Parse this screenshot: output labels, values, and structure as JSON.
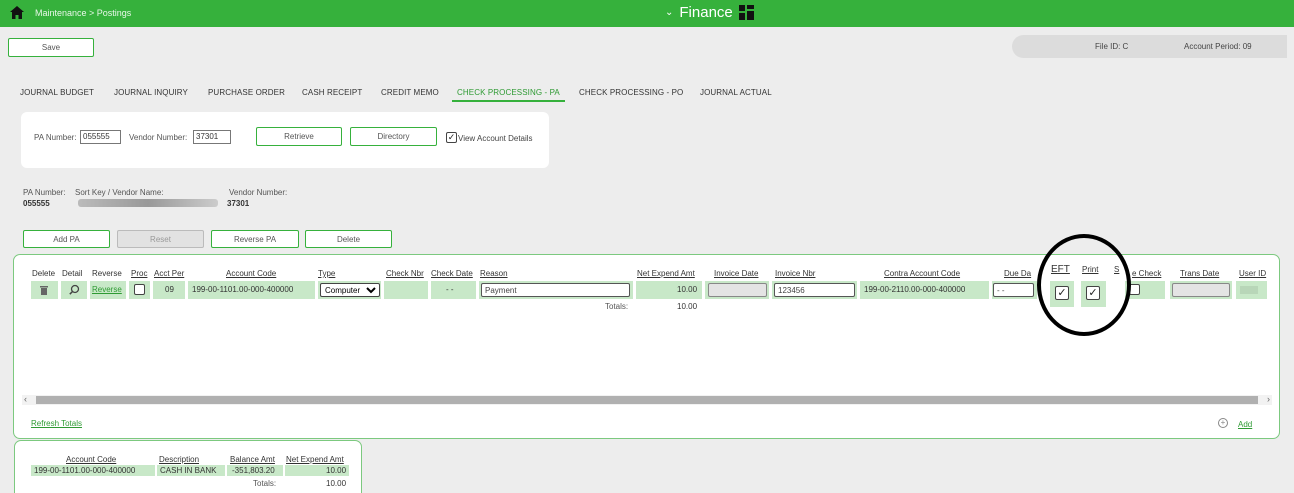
{
  "header": {
    "breadcrumb": "Maintenance > Postings",
    "app_title": "Finance",
    "chevron": "⌄"
  },
  "toolbar": {
    "save_label": "Save"
  },
  "file_info": {
    "file_id": "File ID: C",
    "account_period": "Account Period: 09"
  },
  "tabs": [
    "JOURNAL BUDGET",
    "JOURNAL INQUIRY",
    "PURCHASE ORDER",
    "CASH RECEIPT",
    "CREDIT MEMO",
    "CHECK PROCESSING - PA",
    "CHECK PROCESSING - PO",
    "JOURNAL ACTUAL"
  ],
  "active_tab": "CHECK PROCESSING - PA",
  "search": {
    "pa_number_label": "PA Number:",
    "pa_number_value": "055555",
    "vendor_number_label": "Vendor Number:",
    "vendor_number_value": "37301",
    "retrieve_label": "Retrieve",
    "directory_label": "Directory",
    "view_details_label": "View Account Details",
    "view_details_checked": true
  },
  "info": {
    "pa_number_label": "PA Number:",
    "sort_key_label": "Sort Key / Vendor Name:",
    "vendor_number_label": "Vendor Number:",
    "pa_number_value": "055555",
    "vendor_number_value": "37301"
  },
  "actions": {
    "add_pa": "Add PA",
    "reset": "Reset",
    "reverse_pa": "Reverse PA",
    "delete": "Delete"
  },
  "grid": {
    "headers": {
      "delete": "Delete",
      "detail": "Detail",
      "reverse": "Reverse",
      "proc": "Proc",
      "acct_per": "Acct Per",
      "account_code": "Account Code",
      "type": "Type",
      "check_nbr": "Check Nbr",
      "check_date": "Check Date",
      "reason": "Reason",
      "net_expend_amt": "Net Expend Amt",
      "invoice_date": "Invoice Date",
      "invoice_nbr": "Invoice Nbr",
      "contra_account_code": "Contra Account Code",
      "due_date": "Due Da",
      "eft": "EFT",
      "print": "Print",
      "s_glyph": "S",
      "single_check": "e Check",
      "trans_date": "Trans Date",
      "user_id": "User ID"
    },
    "row": {
      "reverse_link": "Reverse",
      "acct_per": "09",
      "account_code": "199-00-1101.00-000-400000",
      "type": "Computer",
      "check_date": "- -",
      "reason": "Payment",
      "net_expend_amt": "10.00",
      "invoice_nbr": "123456",
      "contra_account_code": "199-00-2110.00-000-400000",
      "due_date": "- -",
      "eft_check": "✓",
      "print_check": "✓"
    },
    "totals_label": "Totals:",
    "totals_value": "10.00",
    "refresh_totals": "Refresh Totals",
    "add_label": "Add"
  },
  "account_summary": {
    "headers": {
      "account_code": "Account Code",
      "description": "Description",
      "balance_amt": "Balance Amt",
      "net_expend_amt": "Net Expend Amt"
    },
    "row": {
      "account_code": "199-00-1101.00-000-400000",
      "description": "CASH IN BANK",
      "balance_amt": "-351,803.20",
      "net_expend_amt": "10.00"
    },
    "totals_label": "Totals:",
    "totals_value": "10.00"
  },
  "colors": {
    "brand": "#36b13c",
    "row_fill": "#c8e8c8",
    "annotation": "#000000"
  }
}
